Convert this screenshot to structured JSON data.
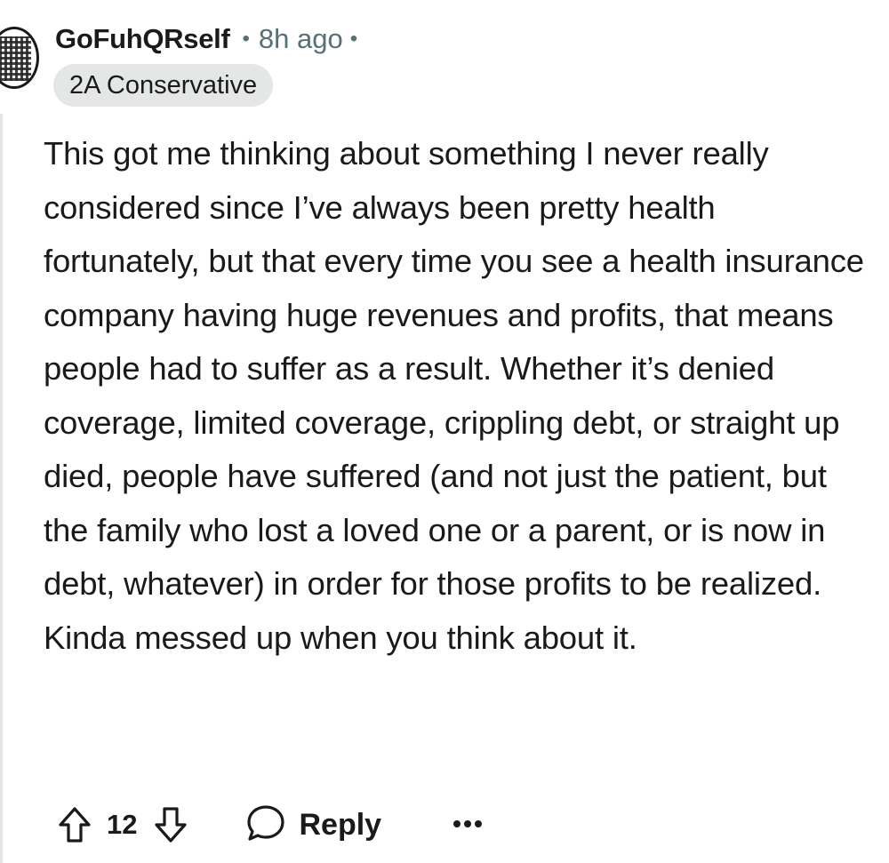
{
  "comment": {
    "author": "GoFuhQRself",
    "separator": "•",
    "timestamp": "8h ago",
    "flair": "2A Conservative",
    "body": "This got me thinking about something I never really considered since I’ve always been pretty health fortunately, but that every time you see a health insurance company having huge revenues and profits, that means people had to suffer as a result. Whether it’s denied coverage, limited coverage, crippling debt, or straight up died, people have suffered (and not just the patient, but the family who lost a loved one or a parent, or is now in debt, whatever) in order for those profits to be realized. Kinda messed up when you think about it."
  },
  "actions": {
    "score": "12",
    "reply_label": "Reply",
    "upvote_icon": "upvote-arrow-icon",
    "downvote_icon": "downvote-arrow-icon",
    "reply_icon": "speech-bubble-icon",
    "more_icon": "ellipsis-icon"
  },
  "colors": {
    "text": "#1a1a1b",
    "meta": "#576f76",
    "flair_bg": "#e5e6e6",
    "thread_line": "#e5e5e5"
  }
}
